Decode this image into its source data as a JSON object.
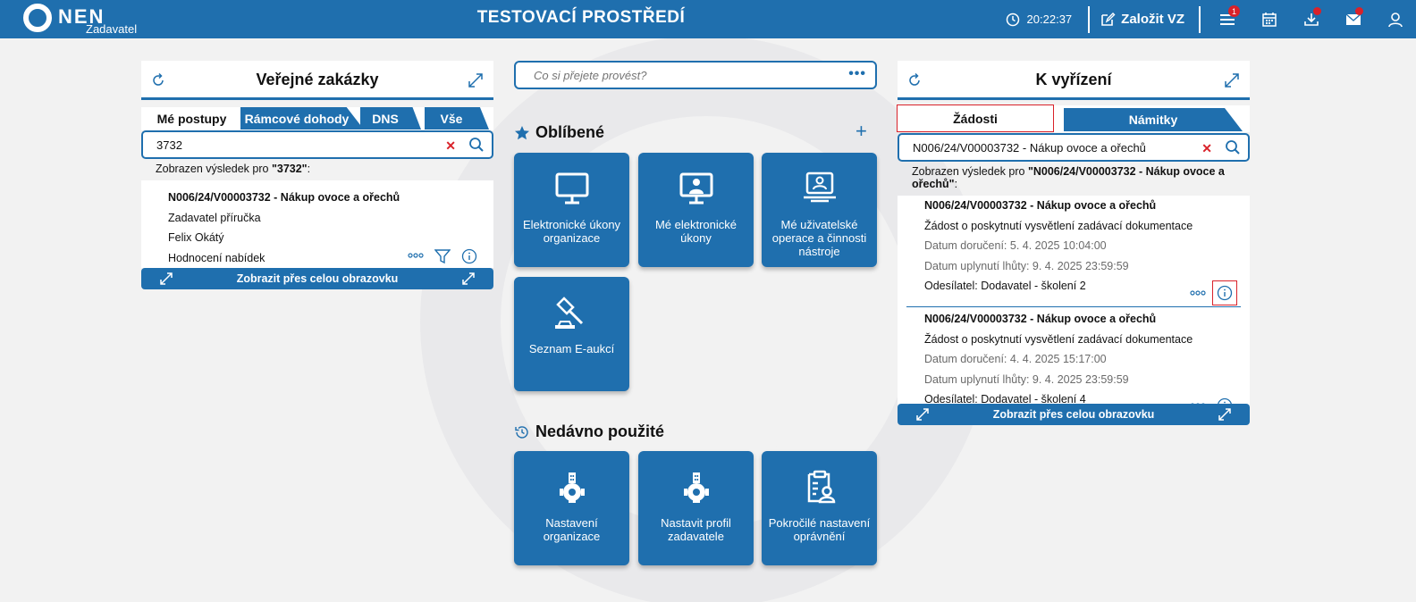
{
  "header": {
    "logo": "NEN",
    "logo_sub": "Zadavatel",
    "env_title": "TESTOVACÍ PROSTŘEDÍ",
    "time": "20:22:37",
    "create_label": "Založit VZ",
    "menu_badge": "1"
  },
  "left": {
    "title": "Veřejné zakázky",
    "tabs": [
      "Mé postupy",
      "Rámcové dohody",
      "DNS",
      "Vše"
    ],
    "search_value": "3732",
    "result_prefix": "Zobrazen výsledek pro ",
    "result_query": "\"3732\"",
    "result_suffix": ":",
    "item": {
      "title": "N006/24/V00003732 - Nákup ovoce a ořechů",
      "line1": "Zadavatel příručka",
      "line2": "Felix Okátý",
      "line3": "Hodnocení nabídek"
    },
    "full_label": "Zobrazit přes celou obrazovku"
  },
  "center": {
    "search_placeholder": "Co si přejete provést?",
    "favorites_title": "Oblíbené",
    "favorites": [
      {
        "label": "Elektronické úkony organizace",
        "icon": "monitor-icon"
      },
      {
        "label": "Mé elektronické úkony",
        "icon": "user-monitor-icon"
      },
      {
        "label": "Mé uživatelské operace a činnosti nástroje",
        "icon": "user-laptop-icon"
      },
      {
        "label": "Seznam E-aukcí",
        "icon": "gavel-icon"
      }
    ],
    "recent_title": "Nedávno použité",
    "recent": [
      {
        "label": "Nastavení organizace",
        "icon": "building-gear-icon"
      },
      {
        "label": "Nastavit profil zadavatele",
        "icon": "building-gear-icon"
      },
      {
        "label": "Pokročilé nastavení oprávnění",
        "icon": "clipboard-user-icon"
      }
    ]
  },
  "right": {
    "title": "K vyřízení",
    "tabs": [
      "Žádosti",
      "Námitky"
    ],
    "search_value": "N006/24/V00003732 - Nákup ovoce a ořechů",
    "result_prefix": "Zobrazen výsledek pro ",
    "result_query": "\"N006/24/V00003732 - Nákup ovoce a ořechů\"",
    "result_suffix": ":",
    "items": [
      {
        "title": "N006/24/V00003732 - Nákup ovoce a ořechů",
        "type": "Žádost o poskytnutí vysvětlení zadávací dokumentace",
        "delivered": "Datum doručení: 5. 4. 2025 10:04:00",
        "deadline": "Datum uplynutí lhůty: 9. 4. 2025 23:59:59",
        "sender": "Odesílatel: Dodavatel - školení 2"
      },
      {
        "title": "N006/24/V00003732 - Nákup ovoce a ořechů",
        "type": "Žádost o poskytnutí vysvětlení zadávací dokumentace",
        "delivered": "Datum doručení: 4. 4. 2025 15:17:00",
        "deadline": "Datum uplynutí lhůty: 9. 4. 2025 23:59:59",
        "sender": "Odesílatel: Dodavatel - školení 4"
      }
    ],
    "full_label": "Zobrazit přes celou obrazovku"
  },
  "colors": {
    "primary": "#1f6fae",
    "alert": "#d9222a"
  }
}
